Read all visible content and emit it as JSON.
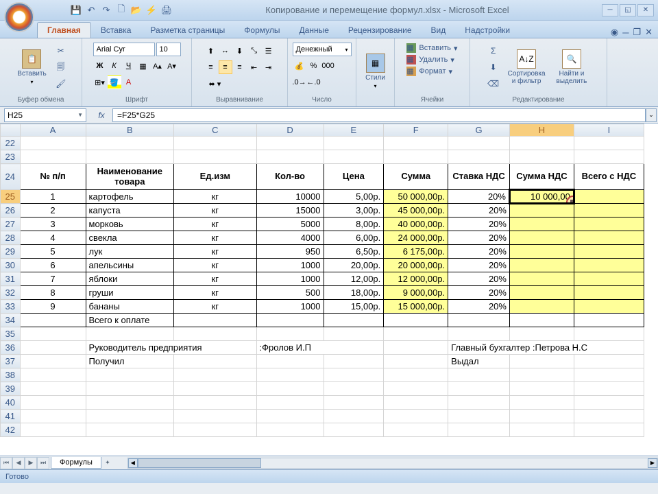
{
  "window": {
    "title": "Копирование и перемещение формул.xlsx - Microsoft Excel"
  },
  "qat": {
    "save": "💾",
    "undo": "↶",
    "redo": "↷",
    "new": "🗋",
    "open": "📂",
    "quick": "⚡",
    "print": "🖨"
  },
  "tabs": [
    "Главная",
    "Вставка",
    "Разметка страницы",
    "Формулы",
    "Данные",
    "Рецензирование",
    "Вид",
    "Надстройки"
  ],
  "ribbon": {
    "clipboard": {
      "paste": "Вставить",
      "label": "Буфер обмена"
    },
    "font": {
      "name": "Arial Cyr",
      "size": "10",
      "label": "Шрифт"
    },
    "align": {
      "label": "Выравнивание"
    },
    "number": {
      "format": "Денежный",
      "label": "Число"
    },
    "styles": {
      "btn": "Стили"
    },
    "cells": {
      "insert": "Вставить",
      "delete": "Удалить",
      "format": "Формат",
      "label": "Ячейки"
    },
    "editing": {
      "sort": "Сортировка\nи фильтр",
      "find": "Найти и\nвыделить",
      "label": "Редактирование"
    }
  },
  "formula_bar": {
    "cell_ref": "H25",
    "formula": "=F25*G25"
  },
  "columns": [
    "A",
    "B",
    "C",
    "D",
    "E",
    "F",
    "G",
    "H",
    "I"
  ],
  "row_start": 22,
  "table": {
    "headers": [
      "№ п/п",
      "Наименование товара",
      "Ед.изм",
      "Кол-во",
      "Цена",
      "Сумма",
      "Ставка НДС",
      "Сумма НДС",
      "Всего с НДС"
    ],
    "rows": [
      {
        "n": "1",
        "name": "картофель",
        "unit": "кг",
        "qty": "10000",
        "price": "5,00р.",
        "sum": "50 000,00р.",
        "rate": "20%",
        "vat": "10 000,00"
      },
      {
        "n": "2",
        "name": "капуста",
        "unit": "кг",
        "qty": "15000",
        "price": "3,00р.",
        "sum": "45 000,00р.",
        "rate": "20%",
        "vat": ""
      },
      {
        "n": "3",
        "name": "морковь",
        "unit": "кг",
        "qty": "5000",
        "price": "8,00р.",
        "sum": "40 000,00р.",
        "rate": "20%",
        "vat": ""
      },
      {
        "n": "4",
        "name": "свекла",
        "unit": "кг",
        "qty": "4000",
        "price": "6,00р.",
        "sum": "24 000,00р.",
        "rate": "20%",
        "vat": ""
      },
      {
        "n": "5",
        "name": "лук",
        "unit": "кг",
        "qty": "950",
        "price": "6,50р.",
        "sum": "6 175,00р.",
        "rate": "20%",
        "vat": ""
      },
      {
        "n": "6",
        "name": "апельсины",
        "unit": "кг",
        "qty": "1000",
        "price": "20,00р.",
        "sum": "20 000,00р.",
        "rate": "20%",
        "vat": ""
      },
      {
        "n": "7",
        "name": "яблоки",
        "unit": "кг",
        "qty": "1000",
        "price": "12,00р.",
        "sum": "12 000,00р.",
        "rate": "20%",
        "vat": ""
      },
      {
        "n": "8",
        "name": "груши",
        "unit": "кг",
        "qty": "500",
        "price": "18,00р.",
        "sum": "9 000,00р.",
        "rate": "20%",
        "vat": ""
      },
      {
        "n": "9",
        "name": "бананы",
        "unit": "кг",
        "qty": "1000",
        "price": "15,00р.",
        "sum": "15 000,00р.",
        "rate": "20%",
        "vat": ""
      }
    ],
    "total_label": "Всего к оплате",
    "footer": {
      "manager_label": "Руководитель предприятия",
      "manager_name": ":Фролов И.П",
      "accountant_label": "Главный бухгалтер :Петрова Н.С",
      "received": "Получил",
      "issued": "Выдал"
    }
  },
  "sheet": {
    "name": "Формулы"
  },
  "status": {
    "ready": "Готово"
  },
  "icons": {
    "bold": "Ж",
    "italic": "К",
    "underline": "Ч",
    "fx": "fx",
    "sigma": "Σ",
    "scissors": "✂",
    "copy": "🗐",
    "brush": "🖌"
  }
}
